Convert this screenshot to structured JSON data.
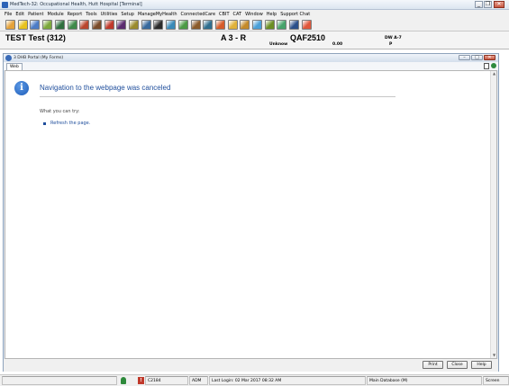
{
  "app": {
    "title": "MedTech-32: Occupational Health, Hutt Hospital  [Terminal]",
    "controls": {
      "minimize": "_",
      "maximize": "❐",
      "close": "✕"
    }
  },
  "menu": [
    "File",
    "Edit",
    "Patient",
    "Module",
    "Report",
    "Tools",
    "Utilities",
    "Setup",
    "ManageMyHealth",
    "ConnectedCare",
    "CBIT",
    "CAT",
    "Window",
    "Help",
    "Support Chat"
  ],
  "toolbar": {
    "colors": [
      "#e5a23a",
      "#e8c21c",
      "#4c7cc6",
      "#7ca83b",
      "#2f6f3e",
      "#3e8a4a",
      "#b9462e",
      "#7a4b2a",
      "#c0392b",
      "#5b2c6f",
      "#9a8b2e",
      "#38699c",
      "#2a2a2a",
      "#3a8ab8",
      "#4c9a45",
      "#8a5a2a",
      "#2f6e8f",
      "#d65c2a",
      "#e0b23a",
      "#c48a2a",
      "#4aa0d8",
      "#6b8e23",
      "#46a36b",
      "#2b4f8a",
      "#e0573a"
    ]
  },
  "patient": {
    "name": "TEST Test (312)",
    "location": "A 3 - R",
    "nhi": "QAF2510",
    "unknown": "Unknow",
    "value": "0.00",
    "doctor": "DW A-7",
    "flag": "P"
  },
  "child": {
    "title": "3 DHB Portal (My Forms)",
    "tab": "Web",
    "controls": {
      "minimize": "–",
      "maximize": "□",
      "close": "✕"
    }
  },
  "browser": {
    "error_title": "Navigation to the webpage was canceled",
    "try_text": "What you can try:",
    "refresh_link": "Refresh the page."
  },
  "buttons": {
    "print": "Print",
    "close": "Close",
    "help": "Help"
  },
  "status": {
    "code": "C2184",
    "user": "ADM",
    "last_login": "Last Login: 02 Mar 2017 08:32 AM",
    "database": "Main Database (M)",
    "screen": "Screen"
  }
}
